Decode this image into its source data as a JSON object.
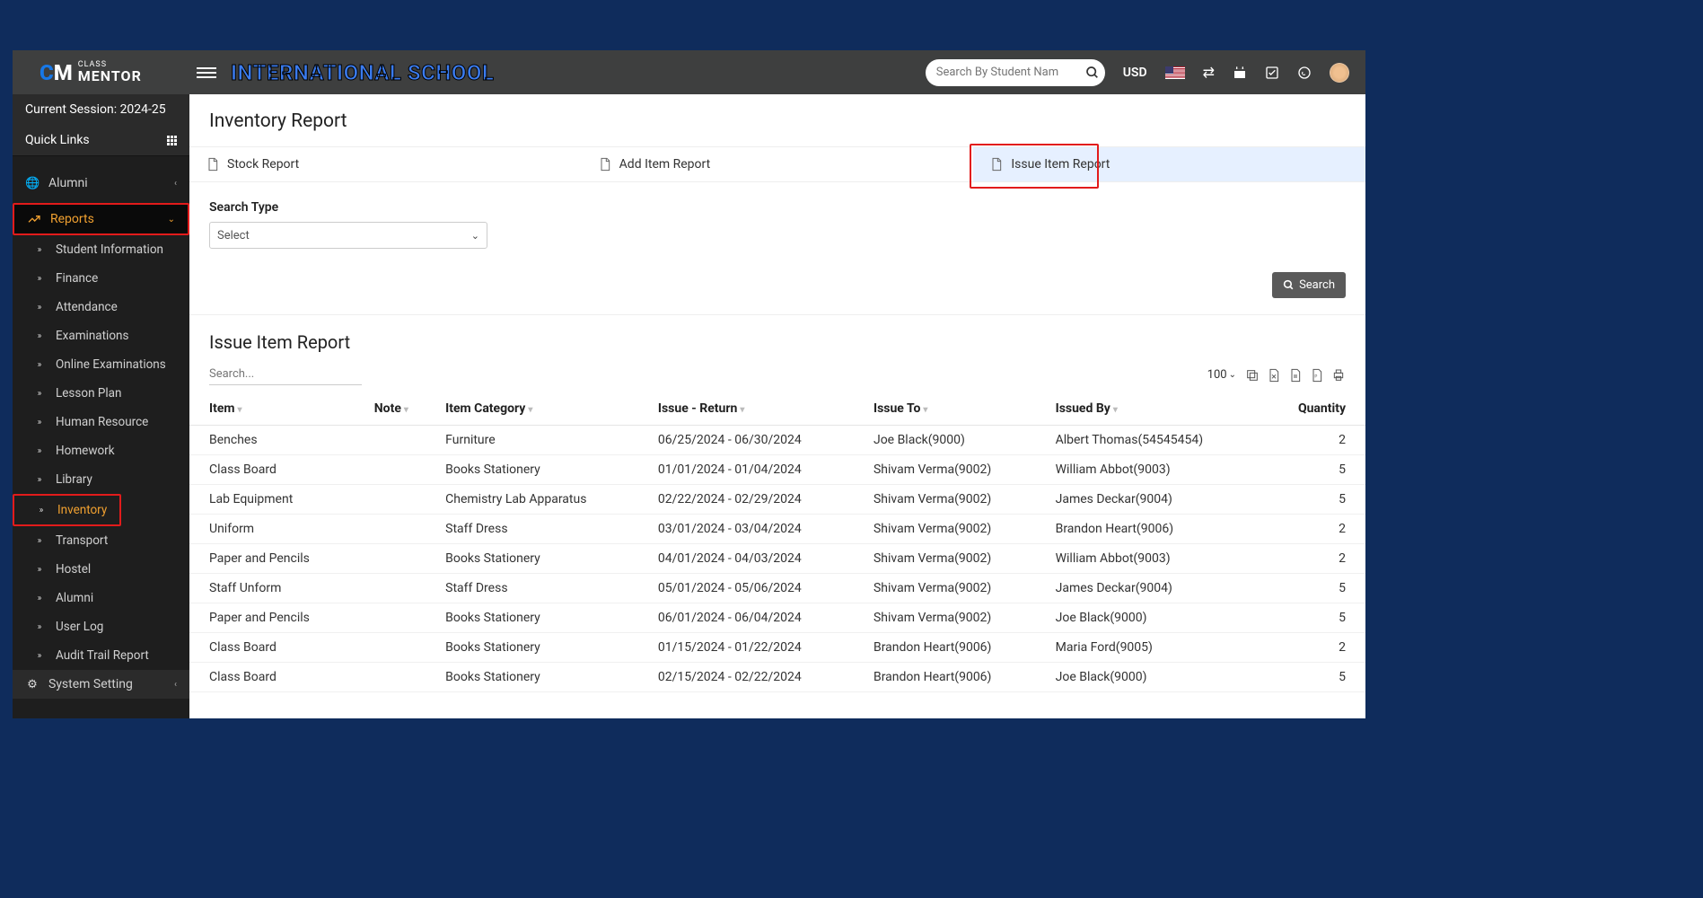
{
  "session": "Current Session: 2024-25",
  "quicklinks": "Quick Links",
  "app_title": "INTERNATIONAL SCHOOL",
  "search_placeholder": "Search By Student Nam",
  "currency": "USD",
  "sidebar": {
    "alumni_top": "Alumni",
    "reports": "Reports",
    "sub": {
      "student_info": "Student Information",
      "finance": "Finance",
      "attendance": "Attendance",
      "examinations": "Examinations",
      "online_exam": "Online Examinations",
      "lesson_plan": "Lesson Plan",
      "hr": "Human Resource",
      "homework": "Homework",
      "library": "Library",
      "inventory": "Inventory",
      "transport": "Transport",
      "hostel": "Hostel",
      "alumni": "Alumni",
      "user_log": "User Log",
      "audit": "Audit Trail Report"
    },
    "system_setting": "System Setting"
  },
  "page": {
    "title": "Inventory Report",
    "tabs": {
      "stock": "Stock Report",
      "add_item": "Add Item Report",
      "issue_item": "Issue Item Report"
    },
    "search_type_label": "Search Type",
    "select_placeholder": "Select",
    "search_btn": "Search",
    "report_title": "Issue Item Report",
    "table_search_placeholder": "Search...",
    "page_size": "100",
    "columns": {
      "item": "Item",
      "note": "Note",
      "category": "Item Category",
      "issue_return": "Issue - Return",
      "issue_to": "Issue To",
      "issued_by": "Issued By",
      "quantity": "Quantity"
    },
    "rows": [
      {
        "item": "Benches",
        "note": "",
        "category": "Furniture",
        "issue_return": "06/25/2024 - 06/30/2024",
        "issue_to": "Joe Black(9000)",
        "issued_by": "Albert Thomas(54545454)",
        "quantity": "2"
      },
      {
        "item": "Class Board",
        "note": "",
        "category": "Books Stationery",
        "issue_return": "01/01/2024 - 01/04/2024",
        "issue_to": "Shivam Verma(9002)",
        "issued_by": "William Abbot(9003)",
        "quantity": "5"
      },
      {
        "item": "Lab Equipment",
        "note": "",
        "category": "Chemistry Lab Apparatus",
        "issue_return": "02/22/2024 - 02/29/2024",
        "issue_to": "Shivam Verma(9002)",
        "issued_by": "James Deckar(9004)",
        "quantity": "5"
      },
      {
        "item": "Uniform",
        "note": "",
        "category": "Staff Dress",
        "issue_return": "03/01/2024 - 03/04/2024",
        "issue_to": "Shivam Verma(9002)",
        "issued_by": "Brandon Heart(9006)",
        "quantity": "2"
      },
      {
        "item": "Paper and Pencils",
        "note": "",
        "category": "Books Stationery",
        "issue_return": "04/01/2024 - 04/03/2024",
        "issue_to": "Shivam Verma(9002)",
        "issued_by": "William Abbot(9003)",
        "quantity": "2"
      },
      {
        "item": "Staff Unform",
        "note": "",
        "category": "Staff Dress",
        "issue_return": "05/01/2024 - 05/06/2024",
        "issue_to": "Shivam Verma(9002)",
        "issued_by": "James Deckar(9004)",
        "quantity": "5"
      },
      {
        "item": "Paper and Pencils",
        "note": "",
        "category": "Books Stationery",
        "issue_return": "06/01/2024 - 06/04/2024",
        "issue_to": "Shivam Verma(9002)",
        "issued_by": "Joe Black(9000)",
        "quantity": "5"
      },
      {
        "item": "Class Board",
        "note": "",
        "category": "Books Stationery",
        "issue_return": "01/15/2024 - 01/22/2024",
        "issue_to": "Brandon Heart(9006)",
        "issued_by": "Maria Ford(9005)",
        "quantity": "2"
      },
      {
        "item": "Class Board",
        "note": "",
        "category": "Books Stationery",
        "issue_return": "02/15/2024 - 02/22/2024",
        "issue_to": "Brandon Heart(9006)",
        "issued_by": "Joe Black(9000)",
        "quantity": "5"
      }
    ]
  }
}
